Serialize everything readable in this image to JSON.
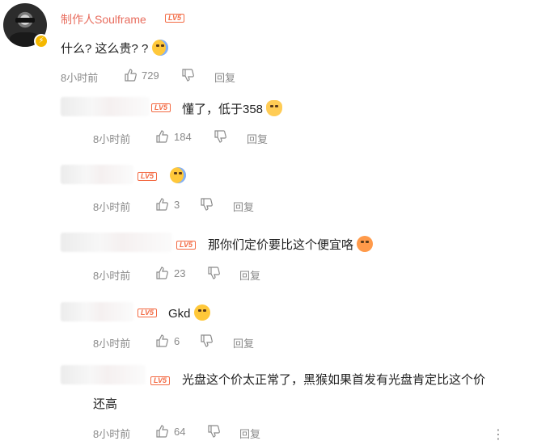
{
  "main": {
    "author": "制作人Soulframe",
    "level": "LV5",
    "text": "什么? 这么贵? ?",
    "time": "8小时前",
    "likes": "729",
    "reply": "回复"
  },
  "replies": [
    {
      "text": "懂了，低于358",
      "time": "8小时前",
      "likes": "184",
      "reply": "回复",
      "level": "LV5"
    },
    {
      "text": "",
      "time": "8小时前",
      "likes": "3",
      "reply": "回复",
      "level": "LV5"
    },
    {
      "text": "那你们定价要比这个便宜咯",
      "time": "8小时前",
      "likes": "23",
      "reply": "回复",
      "level": "LV5"
    },
    {
      "text": "Gkd",
      "time": "8小时前",
      "likes": "6",
      "reply": "回复",
      "level": "LV5"
    },
    {
      "text": "光盘这个价太正常了，黑猴如果首发有光盘肯定比这个价",
      "text2": "还高",
      "time": "8小时前",
      "likes": "64",
      "reply": "回复",
      "level": "LV5"
    }
  ],
  "icons": {
    "like": "thumb-up-icon",
    "dislike": "thumb-down-icon",
    "more": "more-vertical-icon",
    "verified": "verified-badge-icon"
  },
  "colors": {
    "username": "#e86c5d",
    "level": "#f36a43",
    "meta": "#8a8a8a",
    "verified": "#f5b800"
  }
}
